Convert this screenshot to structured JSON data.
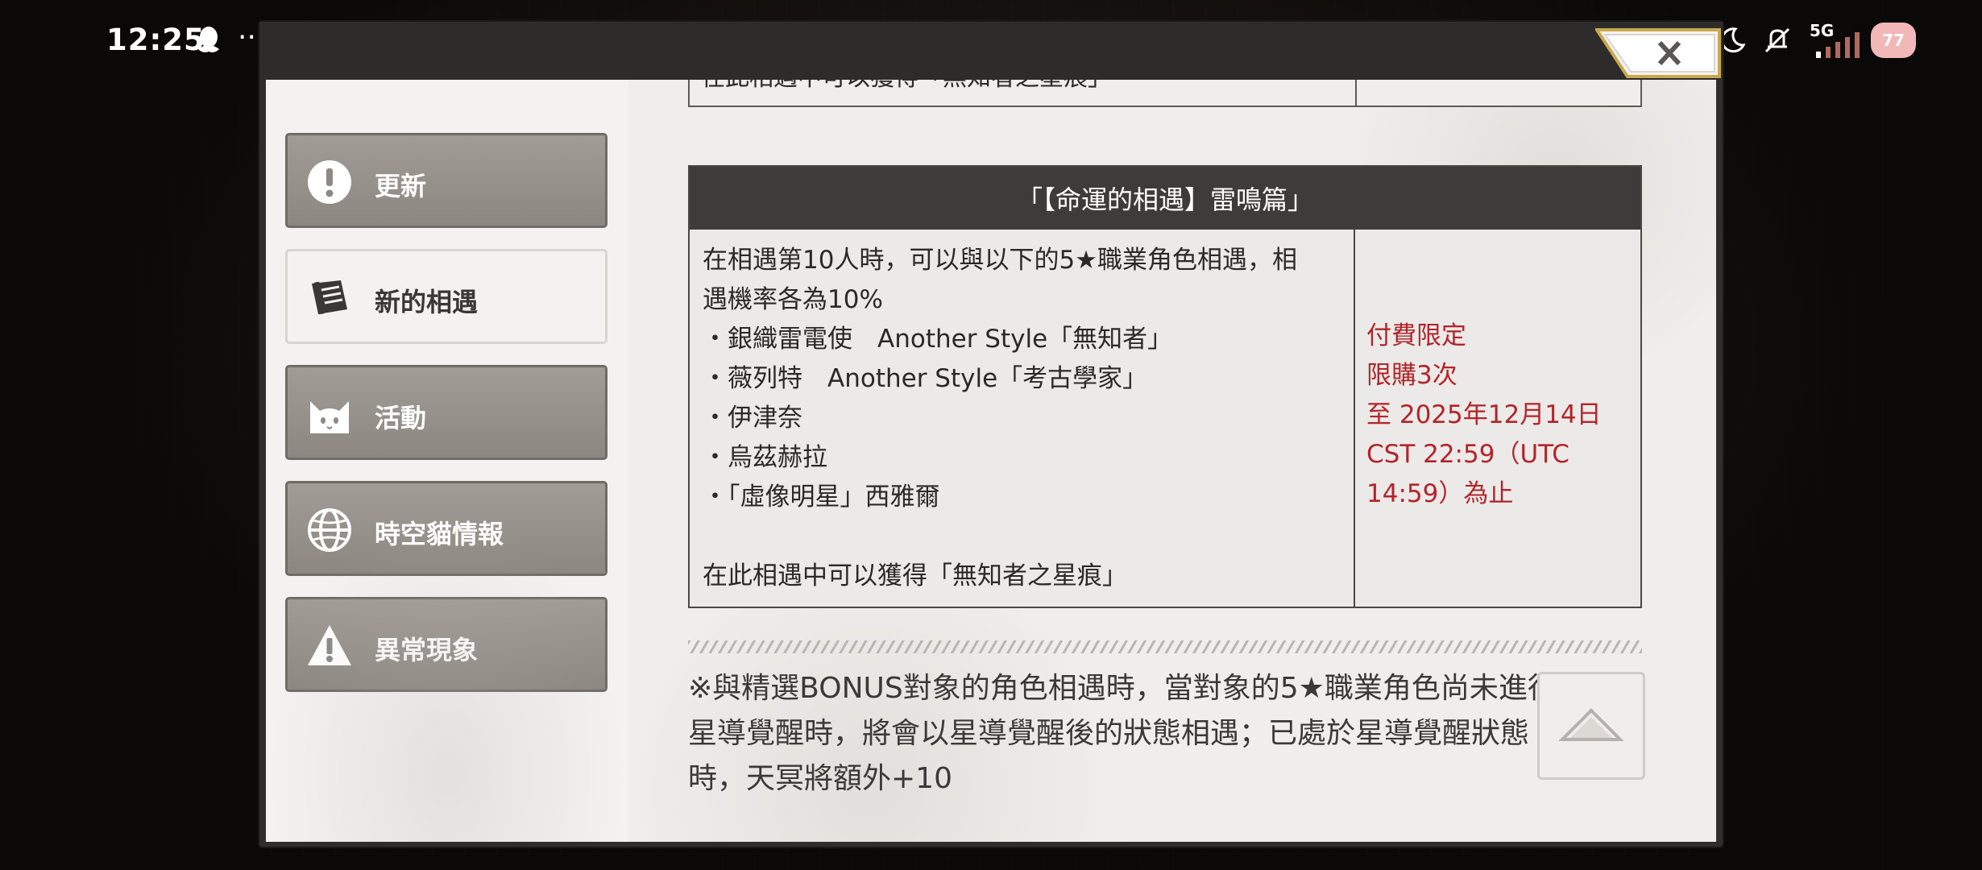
{
  "status_bar": {
    "time": "12:25",
    "dots": "···",
    "network": "5G",
    "battery": "77",
    "icons": [
      "qq-icon",
      "moon-icon",
      "mute-icon",
      "signal-icon"
    ]
  },
  "window": {
    "close_label": "×"
  },
  "sidebar": {
    "items": [
      {
        "label": "更新",
        "icon": "exclamation-icon",
        "active": false
      },
      {
        "label": "新的相遇",
        "icon": "scroll-icon",
        "active": true
      },
      {
        "label": "活動",
        "icon": "cat-icon",
        "active": false
      },
      {
        "label": "時空貓情報",
        "icon": "globe-icon",
        "active": false
      },
      {
        "label": "異常現象",
        "icon": "warning-icon",
        "active": false
      }
    ]
  },
  "content": {
    "previous_row_text": "在此相遇中可以獲得「無知者之星痕」",
    "event": {
      "title": "「【命運的相遇】雷鳴篇」",
      "description_lines": [
        "在相遇第10人時，可以與以下的5★職業角色相遇，相",
        "遇機率各為10%",
        "・銀織雷電使　Another Style「無知者」",
        "・薇列特　Another Style「考古學家」",
        "・伊津奈",
        "・烏茲赫拉",
        "・「虛像明星」西雅爾",
        "",
        "在此相遇中可以獲得「無知者之星痕」"
      ],
      "conditions_lines": [
        "付費限定",
        "限購3次",
        "至 2025年12月14日",
        "CST 22:59（UTC",
        "14:59）為止"
      ]
    },
    "note_lines": [
      "※與精選BONUS對象的角色相遇時，當對象的5★職業角色尚未進行",
      "星導覺醒時，將會以星導覺醒後的狀態相遇；已處於星導覺醒狀態",
      "時，天冥將額外+10"
    ],
    "colors": {
      "accent_red": "#b3242a",
      "header_bg": "#3d3c3a"
    }
  }
}
